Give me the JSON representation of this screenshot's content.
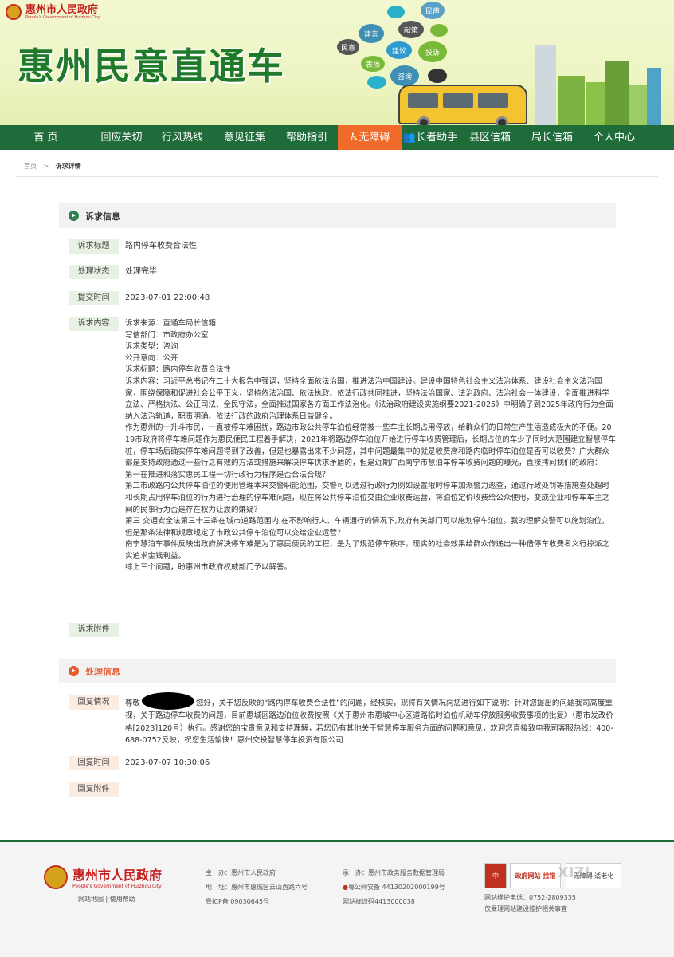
{
  "header": {
    "gov_name": "惠州市人民政府",
    "gov_name_en": "People's Government of Huizhou City",
    "site_title": "惠州民意直通车",
    "bubbles": [
      "民声",
      "建言",
      "献策",
      "民意",
      "建议",
      "投诉",
      "表扬",
      "咨询"
    ]
  },
  "nav": {
    "items": [
      {
        "label": "首 页"
      },
      {
        "label": "回应关切"
      },
      {
        "label": "行风热线"
      },
      {
        "label": "意见征集"
      },
      {
        "label": "帮助指引"
      },
      {
        "label": "无障碍"
      },
      {
        "label": "长者助手"
      },
      {
        "label": "县区信箱"
      },
      {
        "label": "局长信箱"
      },
      {
        "label": "个人中心"
      }
    ],
    "active_color": "#f06b2a",
    "bg_color": "#1f6b3a"
  },
  "breadcrumb": {
    "home": "首页",
    "separator": ">",
    "current": "诉求详情"
  },
  "appeal": {
    "section_title": "诉求信息",
    "labels": {
      "title": "诉求标题",
      "status": "处理状态",
      "submitted": "提交时间",
      "content": "诉求内容",
      "attachment": "诉求附件"
    },
    "title": "路内停车收费合法性",
    "status": "处理完毕",
    "submitted": "2023-07-01 22:00:48",
    "content_lines": [
      "诉求来源：直通车局长信箱",
      "写信部门：市政府办公室",
      "诉求类型：咨询",
      "公开意向：公开",
      "诉求标题：路内停车收费合法性",
      "诉求内容：习近平总书记在二十大报告中强调，坚持全面依法治国，推进法治中国建设。建设中国特色社会主义法治体系、建设社会主义法治国家，围绕保障和促进社会公平正义，坚持依法治国、依法执政、依法行政共同推进，坚持法治国家、法治政府、法治社会一体建设，全面推进科学立法、严格执法、公正司法、全民守法，全面推进国家各方面工作法治化。《法治政府建设实施纲要2021-2025》中明确了到2025年政府行为全面纳入法治轨道，职责明确、依法行政的政府治理体系日益健全。",
      "作为惠州的一升斗市民，一直被停车难困扰，路边市政公共停车泊位经常被一些车主长期占用停放，给群众们的日常生产生活造成极大的不便。2019市政府将停车难问题作为惠民便民工程着手解决，2021年将路边停车泊位开始进行停车收费管理后，长期占位的车少了同时大范围建立智慧停车桩，停车场后确实停车难问题得到了改善，但是也暴露出来不少问题，其中问题最集中的就是收费高和路内临时停车泊位是否可以收费？广大群众都是支持政府通过一些行之有效的方法或措施来解决停车供求矛盾的，但是近期广西南宁市慧泊车停车收费问题的曝光，直接拷问我们的政府：",
      "第一在推进和落实惠民工程一切行政行为程序是否合法合规？",
      "第二市政路内公共停车泊位的使用管理本来交警职能范围，交警可以通过行政行为例如设置限时停车加派警力巡查，通过行政处罚等措施查处超时和长期占用停车泊位的行为进行治理的停车难问题，现在将公共停车泊位交由企业收费运营，将泊位定价收费给公众使用，变成企业和停车车主之间的民事行为否是存在权力让渡的嫌疑？",
      "第三 交通安全法第三十三条在城市道路范围内,在不影响行人、车辆通行的情况下,政府有关部门可以施划停车泊位。我的理解交警可以施划泊位，但是那条法律和规章规定了市政公共停车泊位可以交给企业运营？",
      "南宁慧泊车事件反映出政府解决停车难是为了惠民便民的工程，是为了规范停车秩序。现实的社会效果给群众传递出一种借停车收费名义行掠派之实追求金钱利益。",
      "综上三个问题，盼惠州市政府权威部门予以解答。"
    ]
  },
  "reply": {
    "section_title": "处理信息",
    "labels": {
      "situation": "回复情况",
      "time": "回复时间",
      "attachment": "回复附件"
    },
    "text_before": "尊敬",
    "text_after": "您好，关于您反映的“路内停车收费合法性”的问题，经核实，现将有关情况向您进行如下说明：针对您提出的问题我司高度重视，关于路边停车收费的问题，目前惠城区路边泊位收费按照《关于惠州市惠城中心区道路临时泊位机动车停放服务收费事项的批复》（惠市发改价格[2023]120号）执行。感谢您的宝贵意见和支持理解，若您仍有其他关于智慧停车服务方面的问题和意见，欢迎您直接致电我司客服热线：400-688-0752反映，祝您生活愉快！惠州交投智慧停车投资有限公司",
    "time": "2023-07-07 10:30:06",
    "accent_color": "#e8582a"
  },
  "footer": {
    "gov_name": "惠州市人民政府",
    "gov_name_en": "People's Government of Huizhou City",
    "links": "网站地图 | 使用帮助",
    "host_label": "主　办：",
    "host": "惠州市人民政府",
    "organizer_label": "承　办：",
    "organizer": "惠州市政务服务数据管理局",
    "address_label": "地　址：",
    "address": "惠州市惠城区云山西路六号",
    "police": "粤公网安备 44130202000199号",
    "icp": "粤ICP备 09030645号",
    "site_id": "网站标识码4413000038",
    "hotline": "网站维护电话：0752-2809335",
    "note": "仅受理网站建设维护相关事宜",
    "badge_1": "政府网站 找错",
    "badge_2": "无障碍 适老化",
    "watermark": "XIZI"
  }
}
